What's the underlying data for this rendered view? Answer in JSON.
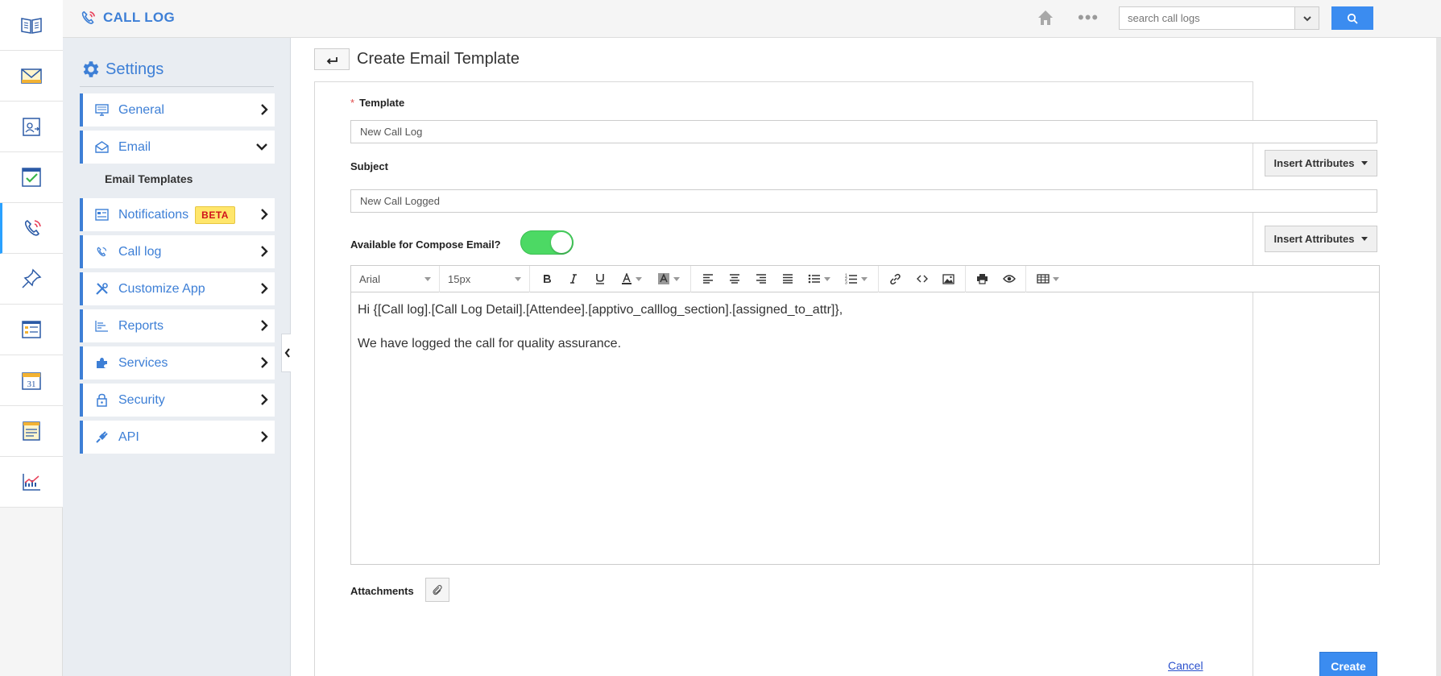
{
  "header": {
    "app_title": "CALL LOG",
    "search_placeholder": "search call logs"
  },
  "rail": {
    "items": [
      "book-icon",
      "mail-icon",
      "contact-card-icon",
      "checklist-icon",
      "call-log-icon",
      "pin-icon",
      "form-icon",
      "calendar-icon",
      "notes-icon",
      "chart-icon"
    ],
    "active_index": 4
  },
  "sidebar": {
    "title": "Settings",
    "items": [
      {
        "label": "General"
      },
      {
        "label": "Email"
      },
      {
        "label": "Email Templates"
      },
      {
        "label": "Notifications",
        "badge": "BETA"
      },
      {
        "label": "Call log"
      },
      {
        "label": "Customize App"
      },
      {
        "label": "Reports"
      },
      {
        "label": "Services"
      },
      {
        "label": "Security"
      },
      {
        "label": "API"
      }
    ]
  },
  "main": {
    "page_title": "Create Email Template",
    "template_label": "Template",
    "required_mark": "*",
    "template_value": "New Call Log",
    "subject_label": "Subject",
    "subject_value": "New Call Logged",
    "insert_attributes_label": "Insert Attributes",
    "compose_label": "Available for Compose Email?",
    "compose_enabled": true,
    "editor": {
      "font_family": "Arial",
      "font_size": "15px",
      "body_line1": "Hi {[Call log].[Call Log Detail].[Attendee].[apptivo_calllog_section].[assigned_to_attr]},",
      "body_line2": "We have logged the call for quality assurance."
    },
    "attachments_label": "Attachments",
    "cancel_label": "Cancel",
    "create_label": "Create"
  },
  "colors": {
    "brand_blue": "#3d7fd6",
    "button_blue": "#3b8cf0",
    "toggle_green": "#4cd964",
    "beta_bg": "#ffe66b",
    "beta_text": "#d0121b"
  }
}
